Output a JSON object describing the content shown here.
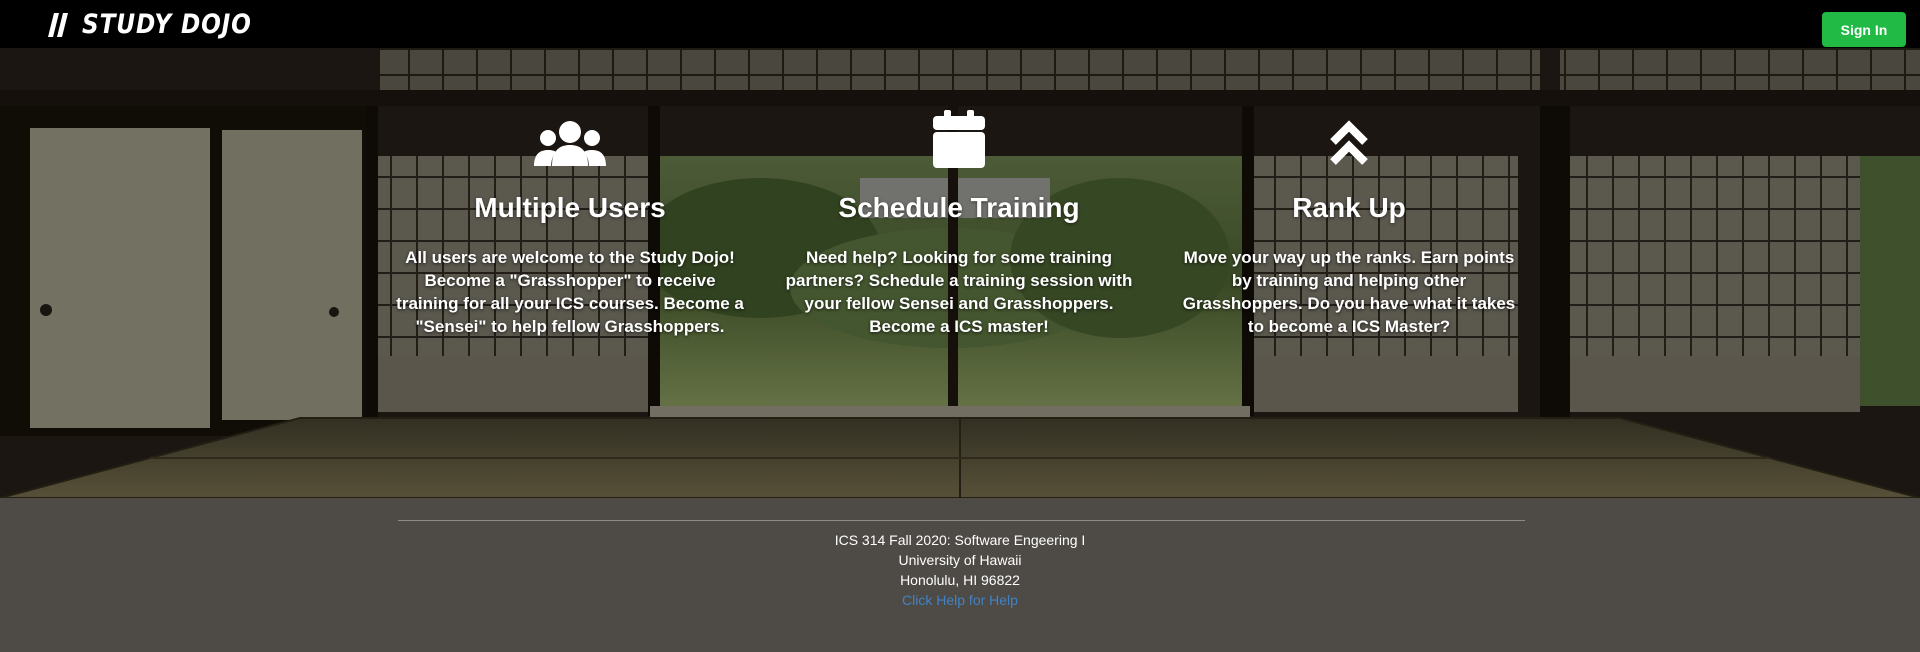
{
  "navbar": {
    "logo_text": "STUDY DOJO",
    "signin_label": "Sign In",
    "signin_color": "#21ba45"
  },
  "features": [
    {
      "icon": "users-icon",
      "title": "Multiple Users",
      "text": "All users are welcome to the Study Dojo! Become a \"Grasshopper\" to receive training for all your ICS courses. Become a \"Sensei\" to help fellow Grasshoppers."
    },
    {
      "icon": "calendar-icon",
      "title": "Schedule Training",
      "text": "Need help? Looking for some training partners? Schedule a training session with your fellow Sensei and Grasshoppers. Become a ICS master!"
    },
    {
      "icon": "double-chevron-up-icon",
      "title": "Rank Up",
      "text": "Move your way up the ranks. Earn points by training and helping other Grasshoppers. Do you have what it takes to become a ICS Master?"
    }
  ],
  "footer": {
    "line1": "ICS 314 Fall 2020: Software Engeering I",
    "line2": "University of Hawaii",
    "line3": "Honolulu, HI 96822",
    "help_link": "Click Help for Help",
    "link_color": "#4183c4"
  }
}
